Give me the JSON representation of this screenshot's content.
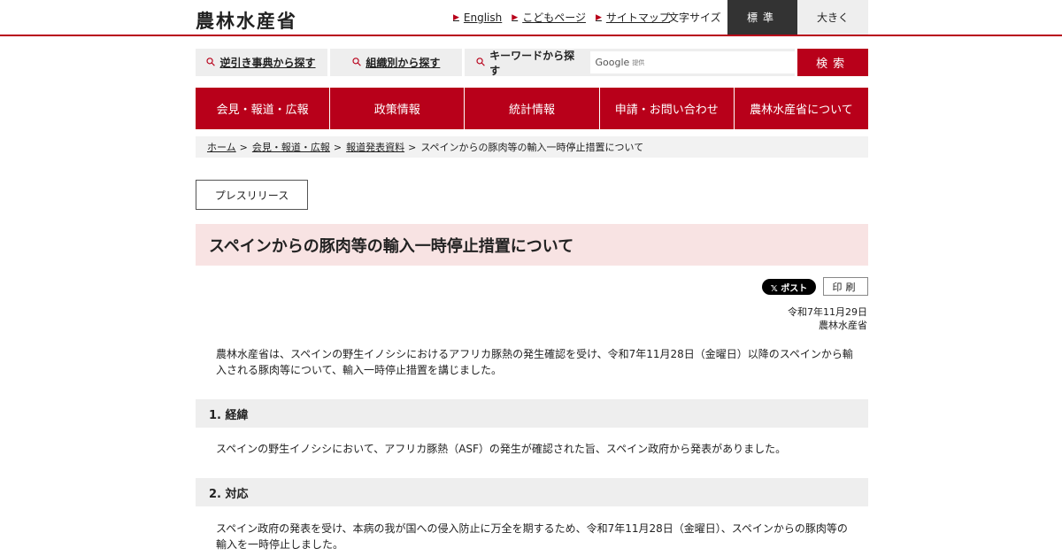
{
  "header": {
    "logo": "農林水産省",
    "links": [
      {
        "label": "English"
      },
      {
        "label": "こどもページ"
      },
      {
        "label": "サイトマップ"
      }
    ],
    "fontsize_label": "文字サイズ",
    "fontsize_standard": "標準",
    "fontsize_large": "大きく"
  },
  "search": {
    "reverse_lookup": "逆引き事典から探す",
    "by_org": "組織別から探す",
    "keyword": "キーワードから探す",
    "google": "Google",
    "google_provided": "提供",
    "button": "検索"
  },
  "gnav": [
    "会見・報道・広報",
    "政策情報",
    "統計情報",
    "申請・お問い合わせ",
    "農林水産省について"
  ],
  "breadcrumb": {
    "items": [
      "ホーム",
      "会見・報道・広報",
      "報道発表資料"
    ],
    "current": "スペインからの豚肉等の輸入一時停止措置について",
    "separator": ">"
  },
  "page": {
    "category": "プレスリリース",
    "title": "スペインからの豚肉等の輸入一時停止措置について",
    "x_post": "𝕏 ポスト",
    "print": "印刷",
    "date": "令和7年11月29日",
    "ministry": "農林水産省",
    "intro": "農林水産省は、スペインの野生イノシシにおけるアフリカ豚熱の発生確認を受け、令和7年11月28日（金曜日）以降のスペインから輸入される豚肉等について、輸入一時停止措置を講じました。",
    "sections": [
      {
        "heading": "1. 経緯",
        "text": "スペインの野生イノシシにおいて、アフリカ豚熱（ASF）の発生が確認された旨、スペイン政府から発表がありました。"
      },
      {
        "heading": "2. 対応",
        "text": "スペイン政府の発表を受け、本病の我が国への侵入防止に万全を期するため、令和7年11月28日（金曜日）、スペインからの豚肉等の輸入を一時停止しました。"
      }
    ]
  },
  "colors": {
    "brand": "#b8001a",
    "title_bg": "#f8e3e3",
    "dark": "#333333"
  },
  "icons": {
    "search": "search-icon",
    "arrow": "chevron-right-icon"
  }
}
